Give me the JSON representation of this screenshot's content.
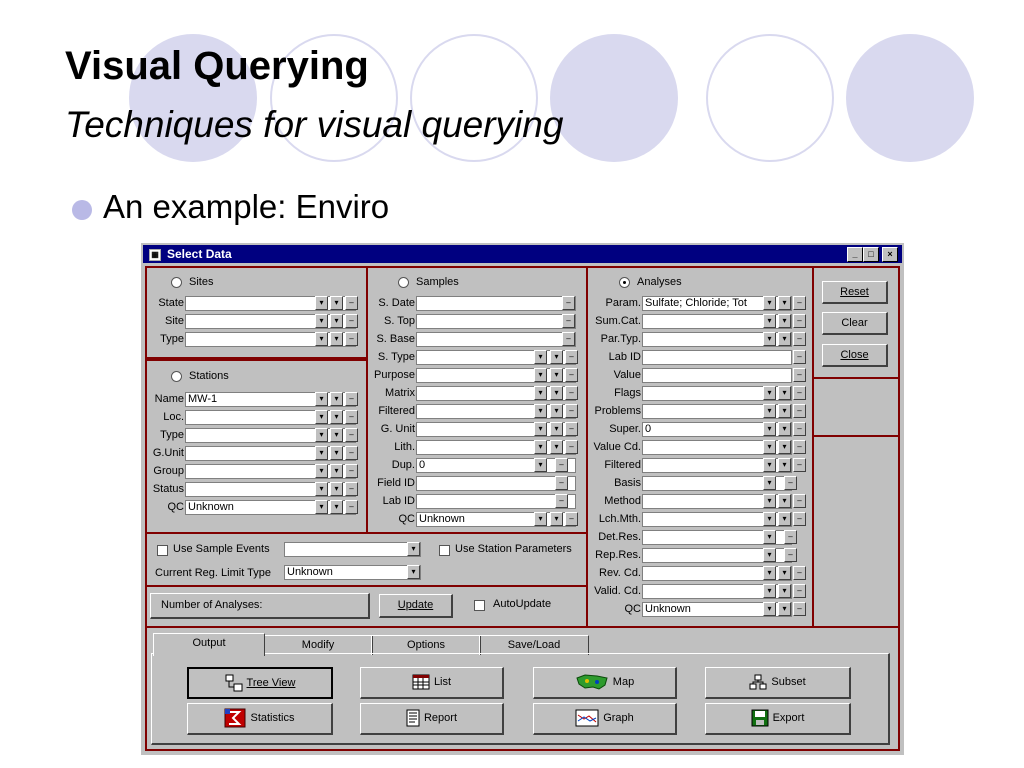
{
  "slide": {
    "title": "Visual Querying",
    "subtitle": "Techniques for visual querying",
    "bullet": "An example: Enviro"
  },
  "window": {
    "title": "Select Data",
    "controls": {
      "minimize": "_",
      "maximize": "□",
      "close": "×"
    }
  },
  "sites": {
    "label": "Sites",
    "rows": [
      {
        "label": "State",
        "value": ""
      },
      {
        "label": "Site",
        "value": ""
      },
      {
        "label": "Type",
        "value": ""
      }
    ]
  },
  "stations": {
    "label": "Stations",
    "rows": [
      {
        "label": "Name",
        "value": "MW-1"
      },
      {
        "label": "Loc.",
        "value": ""
      },
      {
        "label": "Type",
        "value": ""
      },
      {
        "label": "G.Unit",
        "value": ""
      },
      {
        "label": "Group",
        "value": ""
      },
      {
        "label": "Status",
        "value": ""
      },
      {
        "label": "QC",
        "value": "Unknown"
      }
    ]
  },
  "samples": {
    "label": "Samples",
    "rows": [
      {
        "label": "S. Date",
        "value": ""
      },
      {
        "label": "S. Top",
        "value": ""
      },
      {
        "label": "S. Base",
        "value": ""
      },
      {
        "label": "S. Type",
        "value": ""
      },
      {
        "label": "Purpose",
        "value": ""
      },
      {
        "label": "Matrix",
        "value": ""
      },
      {
        "label": "Filtered",
        "value": ""
      },
      {
        "label": "G. Unit",
        "value": ""
      },
      {
        "label": "Lith.",
        "value": ""
      },
      {
        "label": "Dup.",
        "value": "0"
      },
      {
        "label": "Field ID",
        "value": ""
      },
      {
        "label": "Lab ID",
        "value": ""
      },
      {
        "label": "QC",
        "value": "Unknown"
      }
    ]
  },
  "analyses": {
    "label": "Analyses",
    "rows": [
      {
        "label": "Param.",
        "value": "Sulfate; Chloride; Tot"
      },
      {
        "label": "Sum.Cat.",
        "value": ""
      },
      {
        "label": "Par.Typ.",
        "value": ""
      },
      {
        "label": "Lab ID",
        "value": ""
      },
      {
        "label": "Value",
        "value": ""
      },
      {
        "label": "Flags",
        "value": ""
      },
      {
        "label": "Problems",
        "value": ""
      },
      {
        "label": "Super.",
        "value": "0"
      },
      {
        "label": "Value Cd.",
        "value": ""
      },
      {
        "label": "Filtered",
        "value": ""
      },
      {
        "label": "Basis",
        "value": ""
      },
      {
        "label": "Method",
        "value": ""
      },
      {
        "label": "Lch.Mth.",
        "value": ""
      },
      {
        "label": "Det.Res.",
        "value": ""
      },
      {
        "label": "Rep.Res.",
        "value": ""
      },
      {
        "label": "Rev. Cd.",
        "value": ""
      },
      {
        "label": "Valid. Cd.",
        "value": ""
      },
      {
        "label": "QC",
        "value": "Unknown"
      }
    ]
  },
  "actions": {
    "reset": "Reset",
    "clear": "Clear",
    "close": "Close"
  },
  "options": {
    "use_sample_events": "Use Sample Events",
    "sample_events_value": "",
    "use_station_parameters": "Use Station Parameters",
    "reg_limit_label": "Current Reg. Limit Type",
    "reg_limit_value": "Unknown"
  },
  "count": {
    "label": "Number of Analyses:",
    "update": "Update",
    "autoupdate": "AutoUpdate"
  },
  "tabs": [
    "Output",
    "Modify",
    "Options",
    "Save/Load"
  ],
  "outputs": {
    "tree_view": "Tree View",
    "list": "List",
    "map": "Map",
    "subset": "Subset",
    "statistics": "Statistics",
    "report": "Report",
    "graph": "Graph",
    "export": "Export"
  },
  "colors": {
    "titlebar": "#000080",
    "panel_border": "#800000",
    "accent_circle": "#d9d9ef"
  }
}
